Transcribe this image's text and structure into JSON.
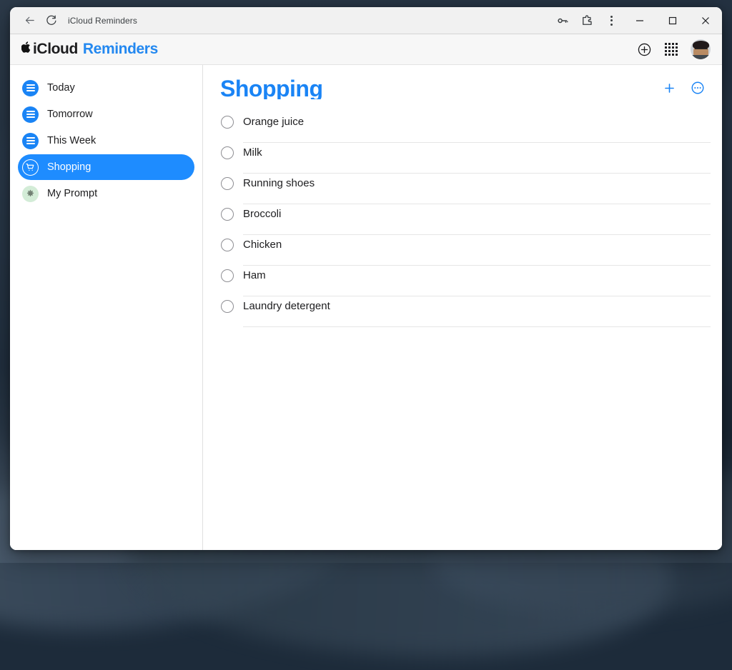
{
  "browser": {
    "title": "iCloud Reminders",
    "back_icon": "back-arrow-icon",
    "reload_icon": "reload-icon",
    "password_icon": "key-icon",
    "extensions_icon": "puzzle-piece-icon",
    "menu_icon": "three-dot-menu-icon",
    "minimize_label": "–",
    "maximize_label": "□",
    "close_label": "✕"
  },
  "header": {
    "apple_logo": "",
    "brand": "iCloud",
    "app_name": "Reminders",
    "add_icon": "plus-circle-icon",
    "apps_grid_icon": "app-grid-icon",
    "avatar_icon": "user-avatar"
  },
  "sidebar": {
    "items": [
      {
        "label": "Today",
        "icon": "list-icon",
        "style": "blue",
        "selected": false
      },
      {
        "label": "Tomorrow",
        "icon": "list-icon",
        "style": "blue",
        "selected": false
      },
      {
        "label": "This Week",
        "icon": "list-icon",
        "style": "blue",
        "selected": false
      },
      {
        "label": "Shopping",
        "icon": "shopping-cart-icon",
        "style": "selected",
        "selected": true
      },
      {
        "label": "My Prompt",
        "icon": "gear-icon",
        "style": "green",
        "selected": false
      }
    ]
  },
  "main": {
    "list_title": "Shopping",
    "add_reminder_icon": "plus-icon",
    "more_options_icon": "more-circle-icon",
    "reminders": [
      {
        "text": "Orange juice",
        "completed": false
      },
      {
        "text": "Milk",
        "completed": false
      },
      {
        "text": "Running shoes",
        "completed": false
      },
      {
        "text": "Broccoli",
        "completed": false
      },
      {
        "text": "Chicken",
        "completed": false
      },
      {
        "text": "Ham",
        "completed": false
      },
      {
        "text": "Laundry detergent",
        "completed": false
      }
    ]
  },
  "colors": {
    "accent_blue": "#1a84f5",
    "selected_blue": "#1e8cff",
    "text_dark": "#1d1d1f",
    "separator": "#e6e6e6",
    "prompt_green": "#d3ecd7"
  }
}
